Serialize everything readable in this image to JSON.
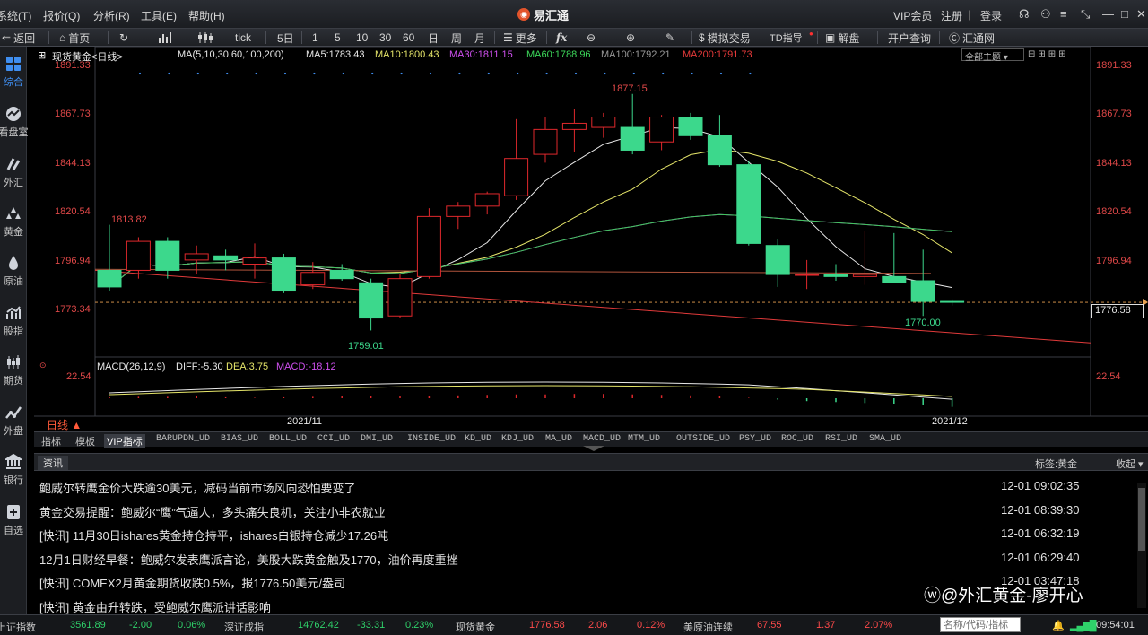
{
  "menubar": {
    "items": [
      "系统(T)",
      "报价(Q)",
      "分析(R)",
      "工具(E)",
      "帮助(H)"
    ],
    "app_title": "易汇通",
    "vip": "VIP会员",
    "register": "注册",
    "login": "登录"
  },
  "toolbar": {
    "back": "返回",
    "home": "首页",
    "tick": "tick",
    "five_day": "5日",
    "periods": [
      "1",
      "5",
      "10",
      "30",
      "60",
      "日",
      "周",
      "月"
    ],
    "more": "更多",
    "fx": "fx",
    "draw": "",
    "sim_trade": "模拟交易",
    "td_index": "TD指导",
    "analysis": "解盘",
    "open_account": "开户查询",
    "huitong": "汇通网"
  },
  "sidebar": {
    "items": [
      {
        "label": "综合",
        "icon": "grid-icon"
      },
      {
        "label": "看盘室",
        "icon": "chart-wave-icon"
      },
      {
        "label": "外汇",
        "icon": "forex-icon"
      },
      {
        "label": "黄金",
        "icon": "gold-bars-icon"
      },
      {
        "label": "原油",
        "icon": "oil-drop-icon"
      },
      {
        "label": "股指",
        "icon": "bar-trend-icon"
      },
      {
        "label": "期货",
        "icon": "candles-icon"
      },
      {
        "label": "外盘",
        "icon": "line-trend-icon"
      },
      {
        "label": "银行",
        "icon": "bank-icon"
      },
      {
        "label": "自选",
        "icon": "plus-doc-icon"
      }
    ]
  },
  "chart": {
    "symbol": "现货黄金<日线>",
    "ma_label": "MA(5,10,30,60,100,200)",
    "ma5": "MA5:1783.43",
    "ma10": "MA10:1800.43",
    "ma30": "MA30:1811.15",
    "ma60": "MA60:1788.96",
    "ma100": "MA100:1792.21",
    "ma200": "MA200:1791.73",
    "theme_select": "全部主题",
    "current_price": "1776.58",
    "y_labels": [
      "1891.33",
      "1867.73",
      "1844.13",
      "1820.54",
      "1796.94",
      "1773.34"
    ],
    "macd_label": "MACD(26,12,9)",
    "diff": "DIFF:-5.30",
    "dea": "DEA:3.75",
    "macd": "MACD:-18.12",
    "macd_y": "22.54",
    "period_label": "日线",
    "x_labels": [
      "2021/11",
      "2021/12"
    ],
    "annotations": {
      "high": "1877.15",
      "left_high": "1813.82",
      "low": "1759.01",
      "last_low": "1770.00"
    }
  },
  "chart_data": {
    "type": "candlestick",
    "title": "现货黄金<日线>",
    "ylim": [
      1759,
      1891.33
    ],
    "colors": {
      "up": "#e0282c",
      "down": "#3cd88c",
      "ma5": "#e8e8e8",
      "ma10": "#e6e66a",
      "ma30": "#c850e6",
      "ma60": "#3cc85a",
      "ma200": "#e03a3a"
    },
    "candles": [
      {
        "o": 1792,
        "h": 1814,
        "l": 1782,
        "c": 1784
      },
      {
        "o": 1792,
        "h": 1808,
        "l": 1788,
        "c": 1806
      },
      {
        "o": 1806,
        "h": 1808,
        "l": 1788,
        "c": 1792
      },
      {
        "o": 1797,
        "h": 1804,
        "l": 1790,
        "c": 1800
      },
      {
        "o": 1799,
        "h": 1802,
        "l": 1792,
        "c": 1797
      },
      {
        "o": 1795,
        "h": 1805,
        "l": 1788,
        "c": 1798
      },
      {
        "o": 1798,
        "h": 1800,
        "l": 1781,
        "c": 1782
      },
      {
        "o": 1785,
        "h": 1796,
        "l": 1783,
        "c": 1791
      },
      {
        "o": 1792,
        "h": 1795,
        "l": 1787,
        "c": 1788
      },
      {
        "o": 1786,
        "h": 1788,
        "l": 1763,
        "c": 1769
      },
      {
        "o": 1770,
        "h": 1790,
        "l": 1769,
        "c": 1788
      },
      {
        "o": 1789,
        "h": 1822,
        "l": 1788,
        "c": 1818
      },
      {
        "o": 1818,
        "h": 1825,
        "l": 1812,
        "c": 1823
      },
      {
        "o": 1823,
        "h": 1830,
        "l": 1819,
        "c": 1829
      },
      {
        "o": 1828,
        "h": 1865,
        "l": 1826,
        "c": 1846
      },
      {
        "o": 1848,
        "h": 1866,
        "l": 1844,
        "c": 1860
      },
      {
        "o": 1860,
        "h": 1870,
        "l": 1849,
        "c": 1863
      },
      {
        "o": 1861,
        "h": 1868,
        "l": 1856,
        "c": 1866
      },
      {
        "o": 1861,
        "h": 1877.15,
        "l": 1848,
        "c": 1850
      },
      {
        "o": 1854,
        "h": 1867,
        "l": 1850,
        "c": 1866
      },
      {
        "o": 1866,
        "h": 1868,
        "l": 1855,
        "c": 1857
      },
      {
        "o": 1857,
        "h": 1867,
        "l": 1842,
        "c": 1843
      },
      {
        "o": 1843,
        "h": 1845,
        "l": 1804,
        "c": 1805
      },
      {
        "o": 1804,
        "h": 1807,
        "l": 1784,
        "c": 1790
      },
      {
        "o": 1790,
        "h": 1797,
        "l": 1783,
        "c": 1790
      },
      {
        "o": 1790,
        "h": 1795,
        "l": 1787,
        "c": 1789
      },
      {
        "o": 1789,
        "h": 1811,
        "l": 1785,
        "c": 1790
      },
      {
        "o": 1789,
        "h": 1810,
        "l": 1787,
        "c": 1786
      },
      {
        "o": 1787,
        "h": 1802,
        "l": 1770,
        "c": 1777
      },
      {
        "o": 1777,
        "h": 1778,
        "l": 1775,
        "c": 1776.58
      }
    ],
    "macd_hist": [
      2,
      3,
      3,
      4,
      2,
      1,
      2,
      3,
      5,
      5,
      4,
      4,
      6,
      7,
      8,
      8,
      9,
      9,
      8,
      7,
      6,
      5,
      1,
      -3,
      -6,
      -8,
      -10,
      -12,
      -15,
      -18.12
    ]
  },
  "indicator_tabs": {
    "tabs": [
      "指标",
      "模板",
      "VIP指标",
      "BARUPDN_UD",
      "BIAS_UD",
      "BOLL_UD",
      "CCI_UD",
      "DMI_UD",
      "INSIDE_UD",
      "KD_UD",
      "KDJ_UD",
      "MA_UD",
      "MACD_UD",
      "MTM_UD",
      "OUTSIDE_UD",
      "PSY_UD",
      "ROC_UD",
      "RSI_UD",
      "SMA_UD"
    ]
  },
  "news": {
    "tab": "资讯",
    "tag": "标签:黄金",
    "collapse": "收起",
    "items": [
      {
        "title": "鲍威尔转鹰金价大跌逾30美元，减码当前市场风向恐怕要变了",
        "time": "12-01 09:02:35"
      },
      {
        "title": "黄金交易提醒：鲍威尔“鹰”气逼人，多头痛失良机，关注小非农就业",
        "time": "12-01 08:39:30"
      },
      {
        "title": "[快讯] 11月30日ishares黄金持仓持平，ishares白银持仓减少17.26吨",
        "time": "12-01 06:32:19"
      },
      {
        "title": "12月1日财经早餐：鲍威尔发表鹰派言论，美股大跌黄金触及1770，油价再度重挫",
        "time": "12-01 06:29:40"
      },
      {
        "title": "[快讯] COMEX2月黄金期货收跌0.5%，报1776.50美元/盎司",
        "time": "12-01 03:47:18"
      },
      {
        "title": "[快讯] 黄金由升转跌，受鲍威尔鹰派讲话影响",
        "time": ""
      }
    ]
  },
  "watermark": "@外汇黄金-廖开心",
  "status": {
    "items": [
      {
        "name": "上证指数",
        "price": "3561.89",
        "chg": "-2.00",
        "pct": "0.06%",
        "chg_color": "down",
        "pct_color": "down"
      },
      {
        "name": "深证成指",
        "price": "14762.42",
        "chg": "-33.31",
        "pct": "0.23%",
        "chg_color": "down",
        "pct_color": "down"
      },
      {
        "name": "现货黄金",
        "price": "1776.58",
        "chg": "2.06",
        "pct": "0.12%",
        "chg_color": "up",
        "pct_color": "up"
      },
      {
        "name": "美原油连续",
        "price": "67.55",
        "chg": "1.37",
        "pct": "2.07%",
        "chg_color": "up",
        "pct_color": "up"
      }
    ],
    "search_placeholder": "名称/代码/指标",
    "clock": "09:54:01"
  }
}
